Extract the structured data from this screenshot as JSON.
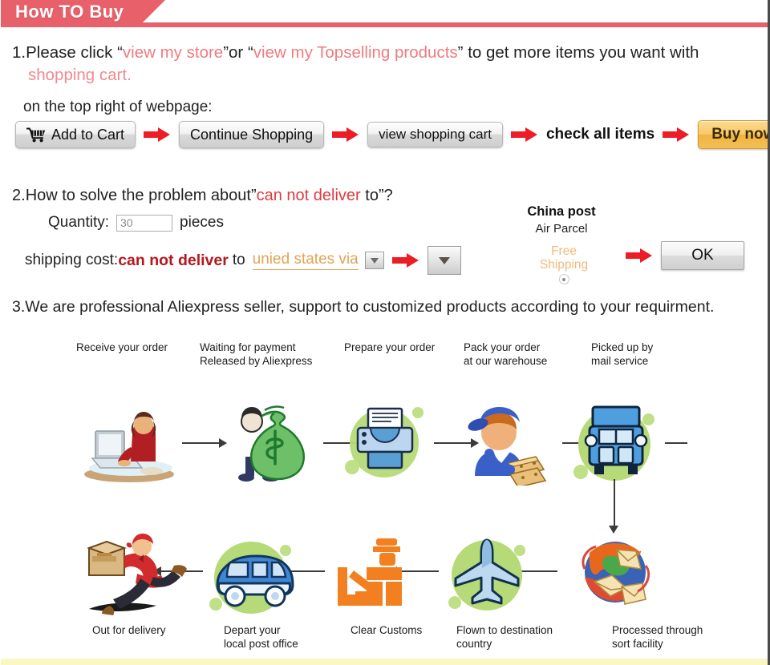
{
  "header": {
    "title": "How TO Buy",
    "tab_color": "#e8606a"
  },
  "section1": {
    "number": "1.",
    "lead": "Please click",
    "quote_open": "“",
    "link1": "view my store",
    "quote_close": "”",
    "or": "or",
    "link2": "view my Topselling products",
    "tail": "to get more items you want with",
    "line2": "shopping cart.",
    "line3": "on the top right of webpage:",
    "link_color": "#ef7b80"
  },
  "flow_buttons": {
    "add_to_cart": "Add to Cart",
    "cart_icon": "shopping-cart-icon",
    "continue_shopping": "Continue Shopping",
    "view_shopping_cart": "view shopping cart",
    "check_all_items": "check all items",
    "buy_now": "Buy now",
    "arrow_icon": "red-right-arrow-icon",
    "buy_now_color": "#f0b43f"
  },
  "section2": {
    "number": "2.",
    "title_a": "How to solve the problem about”",
    "title_b": "can not deliver",
    "title_c": " to”?",
    "quantity_label": "Quantity:",
    "quantity_value": "30",
    "quantity_placeholder": "30",
    "pieces_label": "pieces",
    "shipping_label": "shipping cost:",
    "cannot_deliver": "can not deliver",
    "to_label": "to",
    "destination": "unied states via",
    "dropdown_icon": "chevron-down-icon",
    "arrow_icon": "red-right-arrow-icon",
    "carrier_name": "China post",
    "carrier_service": "Air Parcel",
    "free_shipping_line1": "Free",
    "free_shipping_line2": "Shipping",
    "radio_icon": "radio-selected-icon",
    "ok_button": "OK",
    "red_text_color": "#e03a3f",
    "dest_link_color": "#e0a458"
  },
  "section3": {
    "number": "3.",
    "title": "We are professional Aliexpress seller, support to customized products according to your requirment.",
    "top_captions": [
      {
        "line1": "Receive your order",
        "line2": ""
      },
      {
        "line1": "Waiting for payment",
        "line2": "Released by Aliexpress"
      },
      {
        "line1": "Prepare your order",
        "line2": ""
      },
      {
        "line1": "Pack your order",
        "line2": "at our warehouse"
      },
      {
        "line1": "Picked up by",
        "line2": "mail service"
      }
    ],
    "bottom_captions": [
      {
        "line1": "Out for delivery",
        "line2": ""
      },
      {
        "line1": "Depart your",
        "line2": "local post office"
      },
      {
        "line1": "Clear Customs",
        "line2": ""
      },
      {
        "line1": "Flown to destination",
        "line2": "country"
      },
      {
        "line1": "Processed through",
        "line2": "sort facility"
      }
    ],
    "icons_top": [
      "person-at-laptop-icon",
      "money-bag-icon",
      "printer-icon",
      "warehouse-worker-icon",
      "delivery-truck-icon"
    ],
    "icons_bottom": [
      "running-courier-icon",
      "delivery-van-icon",
      "customs-officer-icon",
      "airplane-icon",
      "mail-sort-globe-icon"
    ],
    "green_accent": "#b5da77"
  }
}
